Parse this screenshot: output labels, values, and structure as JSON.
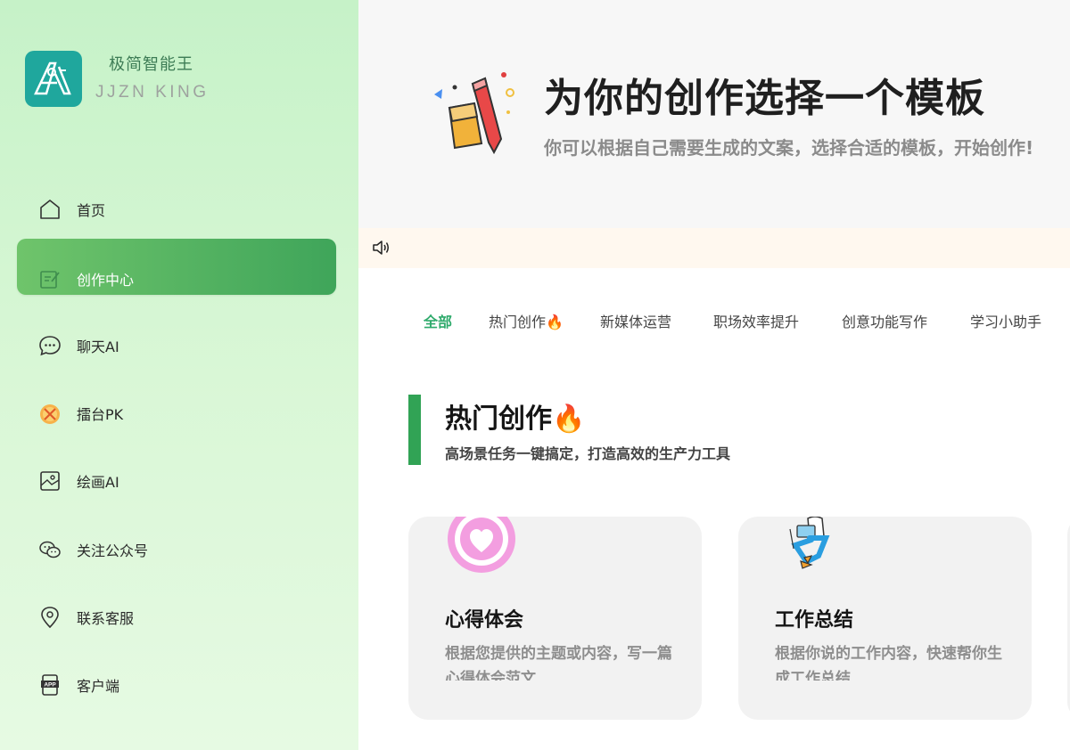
{
  "brand": {
    "name": "极简智能王",
    "subtitle": "JJZN KING",
    "logo_icon": "ai-logo-icon",
    "logo_color": "#1fa79d"
  },
  "sidebar": {
    "items": [
      {
        "label": "首页",
        "icon": "home-icon",
        "active": false
      },
      {
        "label": "创作中心",
        "icon": "edit-note-icon",
        "active": true
      },
      {
        "label": "聊天AI",
        "icon": "chat-bubble-icon",
        "active": false
      },
      {
        "label": "擂台PK",
        "icon": "pk-badge-icon",
        "active": false
      },
      {
        "label": "绘画AI",
        "icon": "image-icon",
        "active": false
      },
      {
        "label": "关注公众号",
        "icon": "wechat-icon",
        "active": false
      },
      {
        "label": "联系客服",
        "icon": "location-pin-icon",
        "active": false
      },
      {
        "label": "客户端",
        "icon": "app-icon",
        "active": false
      }
    ],
    "active_color": "#3fa55a"
  },
  "hero": {
    "title": "为你的创作选择一个模板",
    "subtitle": "你可以根据自己需要生成的文案，选择合适的模板，开始创作!",
    "art_icon": "pencil-eraser-icon"
  },
  "notice": {
    "icon": "speaker-icon"
  },
  "tabs": [
    {
      "label": "全部",
      "active": true
    },
    {
      "label": "热门创作🔥",
      "active": false
    },
    {
      "label": "新媒体运营",
      "active": false
    },
    {
      "label": "职场效率提升",
      "active": false
    },
    {
      "label": "创意功能写作",
      "active": false
    },
    {
      "label": "学习小助手",
      "active": false
    }
  ],
  "section": {
    "title": "热门创作🔥",
    "subtitle": "高场景任务一键搞定，打造高效的生产力工具",
    "accent": "#31a355"
  },
  "cards": [
    {
      "title": "心得体会",
      "desc": "根据您提供的主题或内容，写一篇心得体会范文",
      "icon": "heart-icon"
    },
    {
      "title": "工作总结",
      "desc": "根据你说的工作内容，快速帮你生成工作总结",
      "icon": "person-laptop-icon"
    }
  ]
}
